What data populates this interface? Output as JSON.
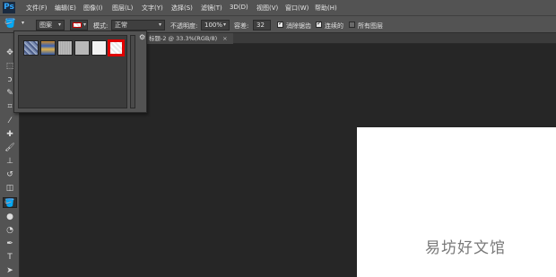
{
  "app": {
    "logo": "Ps"
  },
  "menu": [
    "文件(F)",
    "编辑(E)",
    "图像(I)",
    "图层(L)",
    "文字(Y)",
    "选择(S)",
    "滤镜(T)",
    "3D(D)",
    "视图(V)",
    "窗口(W)",
    "帮助(H)"
  ],
  "options": {
    "source_select": "图案",
    "mode_label": "模式:",
    "mode_value": "正常",
    "opacity_label": "不透明度:",
    "opacity_value": "100%",
    "tolerance_label": "容差:",
    "tolerance_value": "32",
    "antialias_label": "消除锯齿",
    "antialias_checked": true,
    "contiguous_label": "连续的",
    "contiguous_checked": true,
    "all_layers_label": "所有图层",
    "all_layers_checked": false
  },
  "document_tab": {
    "title": "标题-2 @ 33.3%(RGB/8)",
    "close": "×"
  },
  "pattern_picker": {
    "swatches": [
      "bubbles",
      "tie-dye",
      "gray-granite",
      "gray",
      "white",
      "transparent-checker"
    ],
    "selected_index": 5,
    "highlight_color": "#e00000"
  },
  "watermark": "易坊好文馆",
  "colors": {
    "menubar": "#535353",
    "canvas_bg": "#262626",
    "accent_logo": "#31a8ff"
  }
}
